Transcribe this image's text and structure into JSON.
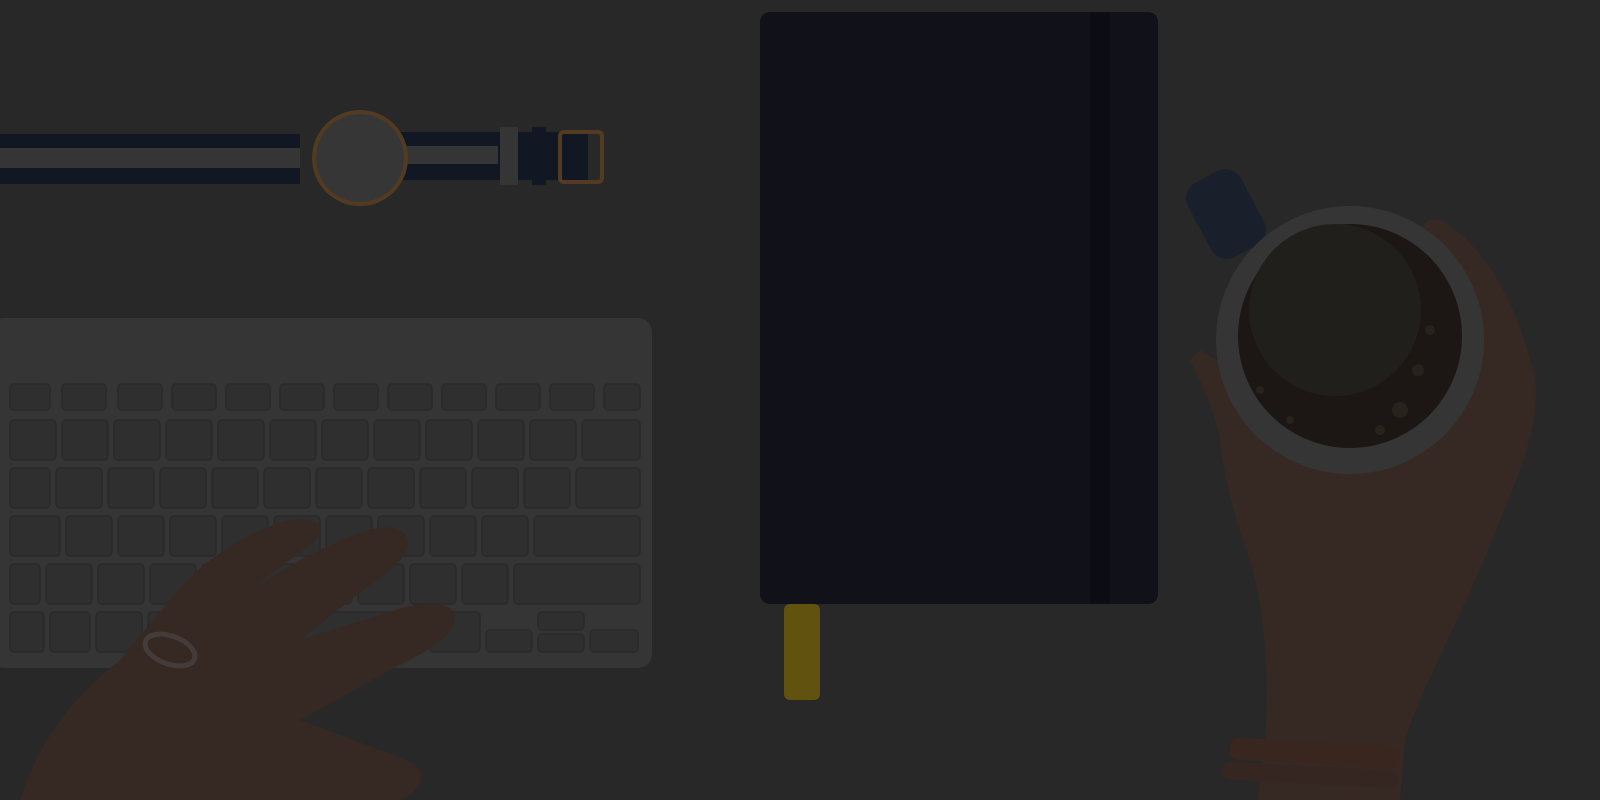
{
  "scene": {
    "description_objects": [
      "wristwatch",
      "keyboard",
      "notebook",
      "coffee-cup",
      "left-hand",
      "right-hand"
    ],
    "palette": {
      "background": "#2a2a2a",
      "overlay": "#000000",
      "notebook": "#12131c",
      "bookmark": "#6b5a12",
      "keyboard": "#3a3a3a",
      "key": "#333333",
      "skin": "#3b2d26",
      "coffee": "#1f1a16",
      "cup": "#3a3a3a",
      "watch_strap_dark": "#151a26",
      "watch_strap_light": "#3a3a3a",
      "watch_gold": "#5a4024",
      "watch_face": "#3b3b3b"
    }
  }
}
